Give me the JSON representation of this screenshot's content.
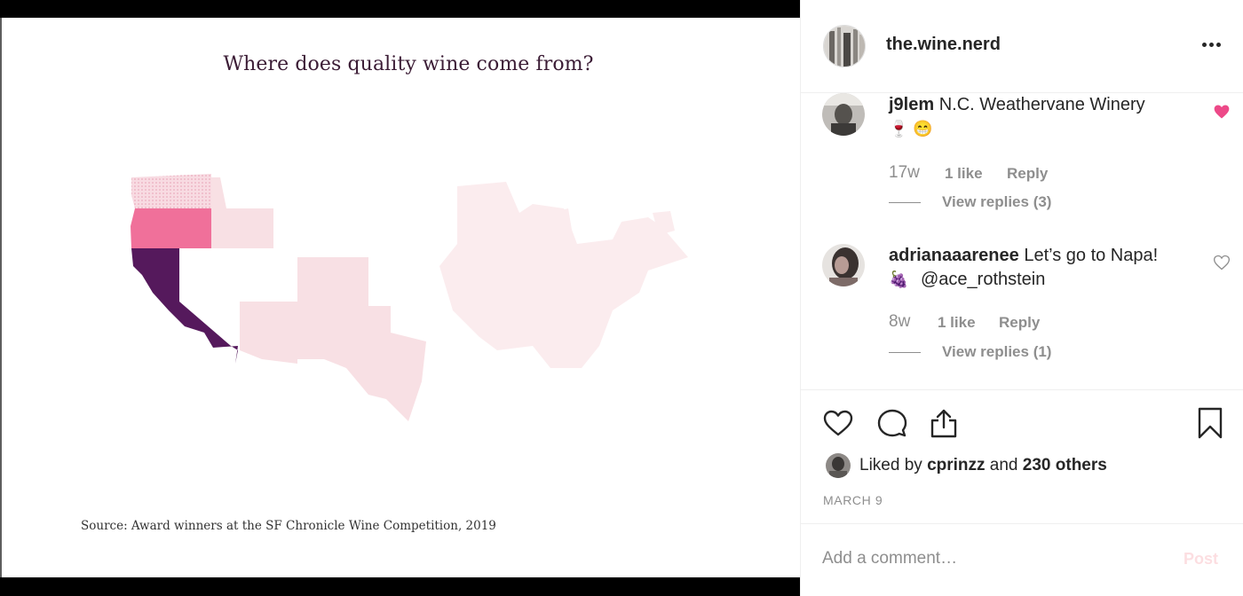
{
  "slide": {
    "title": "Where does quality wine come from?",
    "source": "Source: Award winners at the SF Chronicle Wine Competition, 2019",
    "colors": {
      "california": "#55195c",
      "oregon": "#f0709a",
      "washington": "#f6c9d4",
      "other_west": "#f8e0e4",
      "east": "#fbecee"
    }
  },
  "post": {
    "username": "the.wine.nerd",
    "more_icon": "more-options-icon",
    "comments": [
      {
        "user": "j9lem",
        "text": "N.C. Weathervane Winery",
        "emoji": "🍷 😁",
        "age": "17w",
        "likes": "1 like",
        "reply": "Reply",
        "view_replies": "View replies (3)",
        "liked": true
      },
      {
        "user": "adrianaaarenee",
        "text": "Let’s go to Napa!",
        "emoji": "🍇",
        "mention": "@ace_rothstein",
        "age": "8w",
        "likes": "1 like",
        "reply": "Reply",
        "view_replies": "View replies (1)",
        "liked": false
      }
    ],
    "liked_by_prefix": "Liked by",
    "liked_by_user": "cprinzz",
    "liked_by_and": "and",
    "liked_by_others": "230 others",
    "date": "MARCH 9",
    "comment_placeholder": "Add a comment…",
    "post_label": "Post",
    "accent": "#ed4956"
  }
}
